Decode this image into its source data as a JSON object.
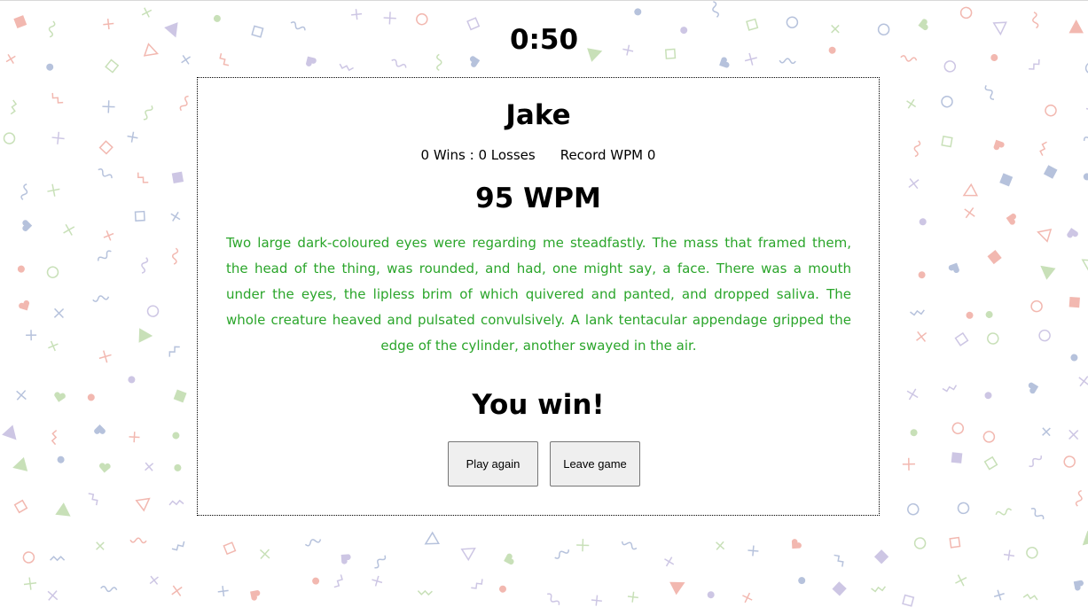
{
  "timer": "0:50",
  "player": {
    "name": "Jake",
    "record": "0 Wins : 0 Losses",
    "record_wpm": "Record WPM 0"
  },
  "wpm": "95 WPM",
  "passage": "Two large dark-coloured eyes were regarding me steadfastly. The mass that framed them, the head of the thing, was rounded, and had, one might say, a face. There was a mouth under the eyes, the lipless brim of which quivered and panted, and dropped saliva. The whole creature heaved and pulsated convulsively. A lank tentacular appendage gripped the edge of the cylinder, another swayed in the air.",
  "result": "You win!",
  "buttons": {
    "play_again": "Play again",
    "leave_game": "Leave game"
  },
  "colors": {
    "passage_text": "#2aa52a",
    "pattern": [
      "#f2b8b0",
      "#b6c2dc",
      "#c8e0b8",
      "#cdc6e4"
    ]
  }
}
